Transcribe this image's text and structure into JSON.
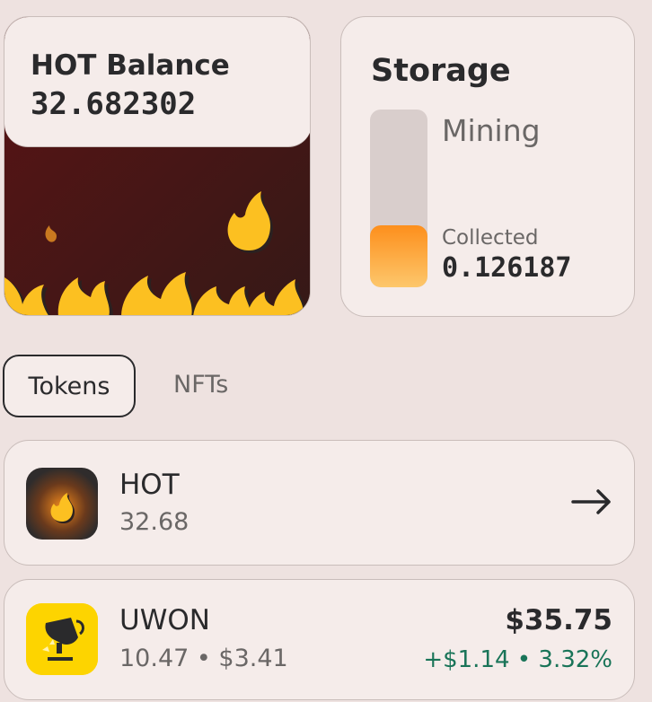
{
  "balance": {
    "title": "HOT Balance",
    "value": "32.682302"
  },
  "storage": {
    "title": "Storage",
    "mining_label": "Mining",
    "collected_label": "Collected",
    "collected_value": "0.126187",
    "fill_fraction": 0.35
  },
  "tabs": [
    {
      "label": "Tokens",
      "active": true
    },
    {
      "label": "NFTs",
      "active": false
    }
  ],
  "tokens": [
    {
      "name": "HOT",
      "sub": "32.68",
      "icon": "hot-flame-icon"
    },
    {
      "name": "UWON",
      "sub": "10.47 • $3.41",
      "value": "$35.75",
      "change": "+$1.14 • 3.32%",
      "icon": "uwon-trophy-icon"
    }
  ],
  "colors": {
    "background": "#eee2e0",
    "card": "#f5ecea",
    "fire_bg": "#3a1513",
    "flame": "#fcc021",
    "storage_fill_top": "#fd8f1c",
    "storage_fill_bottom": "#fdc76c",
    "positive": "#197458",
    "uwon_bg": "#fdd400"
  }
}
